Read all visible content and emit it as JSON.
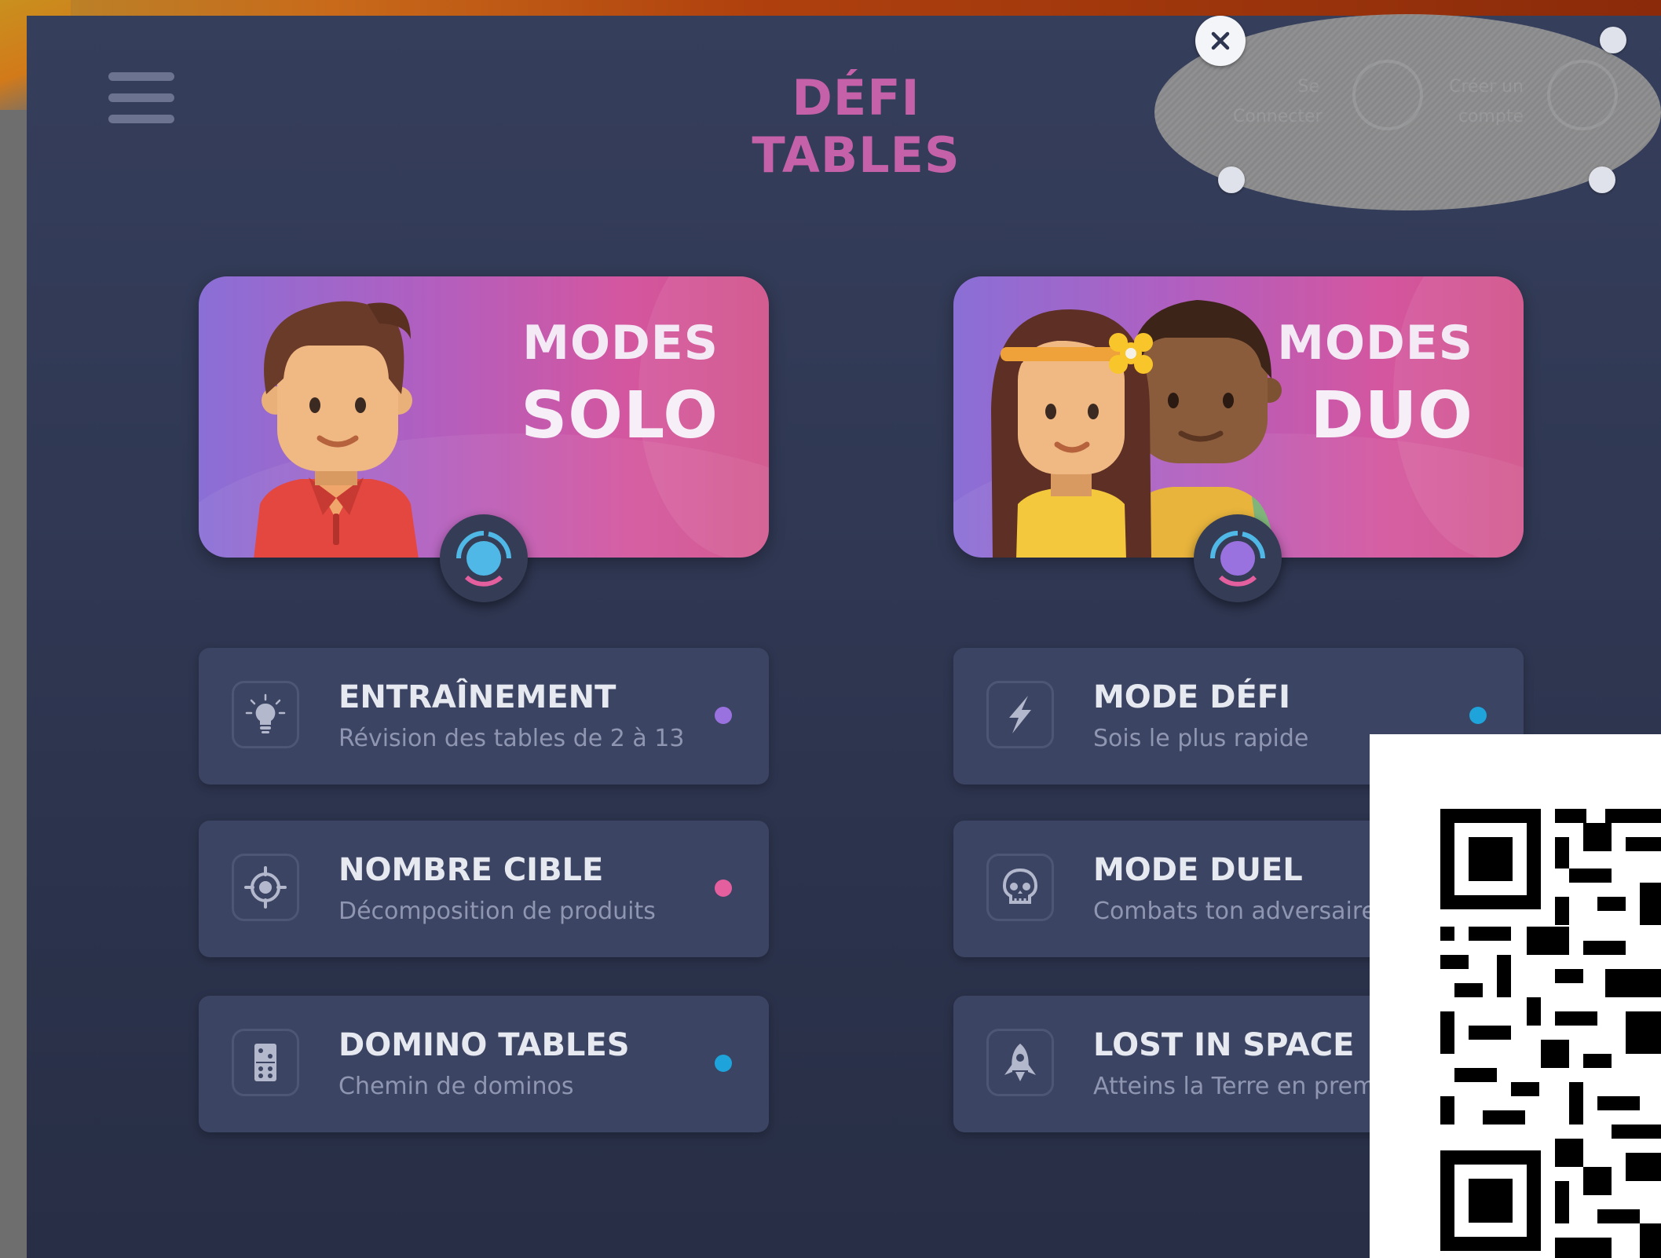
{
  "app": {
    "title": "DÉFI TABLES"
  },
  "auth": {
    "login_label_1": "Se",
    "login_label_2": "Connecter",
    "signup_label_1": "Créer un",
    "signup_label_2": "compte"
  },
  "modes": [
    {
      "line1": "MODES",
      "line2": "SOLO",
      "knob_color": "#4fb8e6"
    },
    {
      "line1": "MODES",
      "line2": "DUO",
      "knob_color": "#9a72e0"
    }
  ],
  "solo_items": [
    {
      "title": "ENTRAÎNEMENT",
      "subtitle": "Révision des tables de 2 à 13",
      "icon": "lightbulb-icon",
      "dot_color": "#9a72e0"
    },
    {
      "title": "NOMBRE CIBLE",
      "subtitle": "Décomposition de produits",
      "icon": "target-icon",
      "dot_color": "#e45f9e"
    },
    {
      "title": "DOMINO TABLES",
      "subtitle": "Chemin de dominos",
      "icon": "domino-icon",
      "dot_color": "#1ea3db"
    }
  ],
  "duo_items": [
    {
      "title": "MODE DÉFI",
      "subtitle": "Sois le plus rapide",
      "icon": "lightning-icon",
      "dot_color": "#1ea3db"
    },
    {
      "title": "MODE DUEL",
      "subtitle": "Combats ton adversaire",
      "icon": "skull-icon"
    },
    {
      "title": "LOST IN SPACE",
      "subtitle": "Atteins la Terre en premi",
      "icon": "rocket-icon"
    }
  ]
}
